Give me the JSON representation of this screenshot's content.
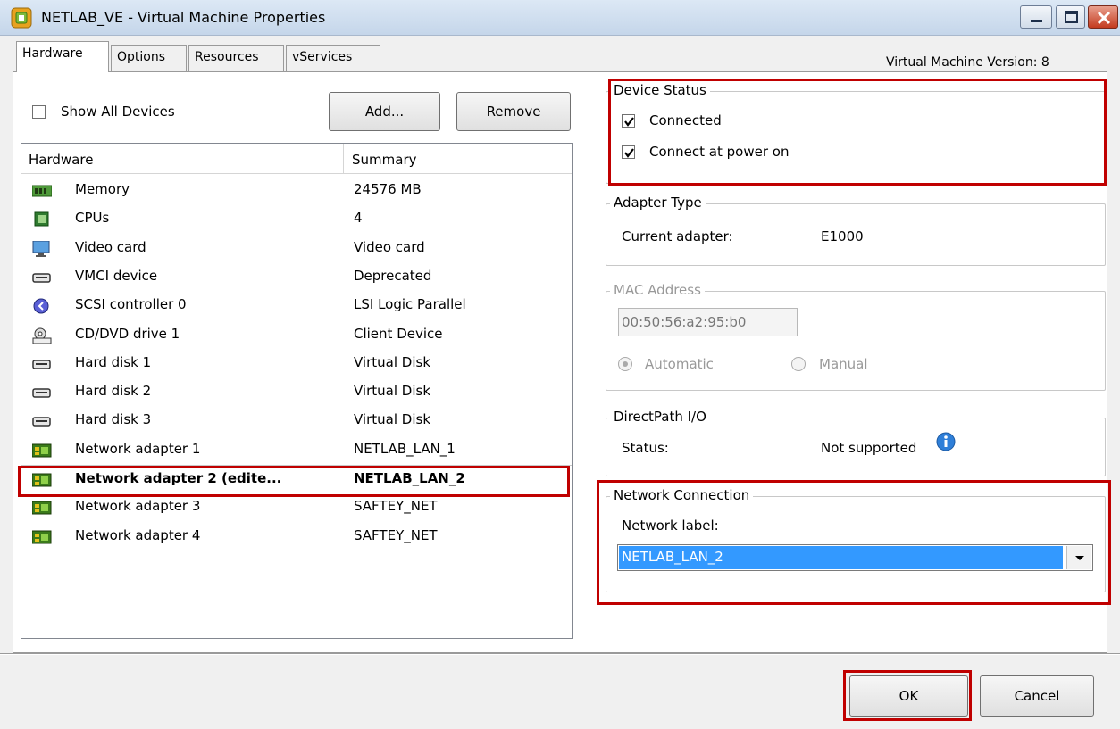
{
  "window": {
    "title": "NETLAB_VE - Virtual Machine Properties"
  },
  "tabs": [
    {
      "label": "Hardware"
    },
    {
      "label": "Options"
    },
    {
      "label": "Resources"
    },
    {
      "label": "vServices"
    }
  ],
  "version_label": "Virtual Machine Version: 8",
  "show_all_devices": {
    "label": "Show All Devices",
    "checked": false
  },
  "buttons": {
    "add": "Add...",
    "remove": "Remove",
    "ok": "OK",
    "cancel": "Cancel"
  },
  "hardware_table": {
    "headers": [
      "Hardware",
      "Summary"
    ],
    "rows": [
      {
        "name": "Memory",
        "summary": "24576 MB",
        "icon": "memory-icon"
      },
      {
        "name": "CPUs",
        "summary": "4",
        "icon": "cpu-icon"
      },
      {
        "name": "Video card",
        "summary": "Video card",
        "icon": "monitor-icon"
      },
      {
        "name": "VMCI device",
        "summary": "Deprecated",
        "icon": "device-icon"
      },
      {
        "name": "SCSI controller 0",
        "summary": "LSI Logic Parallel",
        "icon": "scsi-icon"
      },
      {
        "name": "CD/DVD drive 1",
        "summary": "Client Device",
        "icon": "cd-drive-icon"
      },
      {
        "name": "Hard disk 1",
        "summary": "Virtual Disk",
        "icon": "disk-icon"
      },
      {
        "name": "Hard disk 2",
        "summary": "Virtual Disk",
        "icon": "disk-icon"
      },
      {
        "name": "Hard disk 3",
        "summary": "Virtual Disk",
        "icon": "disk-icon"
      },
      {
        "name": "Network adapter 1",
        "summary": "NETLAB_LAN_1",
        "icon": "network-adapter-icon"
      },
      {
        "name": "Network adapter 2 (edite...",
        "summary": "NETLAB_LAN_2",
        "icon": "network-adapter-icon",
        "selected": true
      },
      {
        "name": "Network adapter 3",
        "summary": "SAFTEY_NET",
        "icon": "network-adapter-icon"
      },
      {
        "name": "Network adapter 4",
        "summary": "SAFTEY_NET",
        "icon": "network-adapter-icon"
      }
    ]
  },
  "device_status": {
    "title": "Device Status",
    "connected": {
      "label": "Connected",
      "checked": true
    },
    "connect_at_power_on": {
      "label": "Connect at power on",
      "checked": true
    }
  },
  "adapter_type": {
    "title": "Adapter Type",
    "label": "Current adapter:",
    "value": "E1000"
  },
  "mac_address": {
    "title": "MAC Address",
    "value": "00:50:56:a2:95:b0",
    "automatic_label": "Automatic",
    "manual_label": "Manual",
    "selected": "Automatic"
  },
  "directpath": {
    "title": "DirectPath I/O",
    "label": "Status:",
    "value": "Not supported"
  },
  "network_connection": {
    "title": "Network Connection",
    "label": "Network label:",
    "selected": "NETLAB_LAN_2"
  },
  "colors": {
    "highlight_red": "#c00000",
    "selection_blue": "#3399ff"
  }
}
